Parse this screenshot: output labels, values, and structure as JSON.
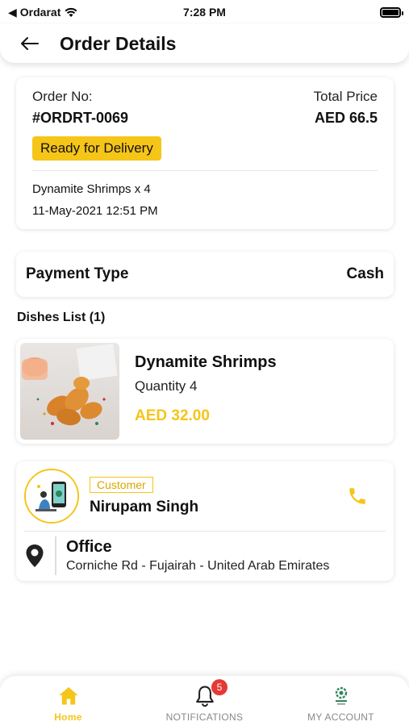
{
  "status_bar": {
    "carrier": "Ordarat",
    "time": "7:28 PM",
    "battery_level": 1.0
  },
  "header": {
    "title": "Order Details"
  },
  "order": {
    "number_label": "Order No:",
    "number": "#ORDRT-0069",
    "total_label": "Total Price",
    "total": "AED 66.5",
    "status": "Ready for Delivery",
    "item_summary": "Dynamite Shrimps x 4",
    "datetime": "11-May-2021 12:51 PM"
  },
  "payment": {
    "label": "Payment Type",
    "value": "Cash"
  },
  "dishes": {
    "title": "Dishes List (1)",
    "items": [
      {
        "name": "Dynamite Shrimps",
        "quantity": "Quantity 4",
        "price": "AED 32.00"
      }
    ]
  },
  "customer": {
    "badge": "Customer",
    "name": "Nirupam Singh",
    "address_title": "Office",
    "address": "Corniche Rd - Fujairah - United Arab Emirates"
  },
  "nav": {
    "items": [
      {
        "label": "Home",
        "icon": "home-icon",
        "active": true
      },
      {
        "label": "NOTIFICATIONS",
        "icon": "bell-icon",
        "badge": "5"
      },
      {
        "label": "MY ACCOUNT",
        "icon": "account-logo-icon"
      }
    ]
  },
  "colors": {
    "accent": "#f5c518",
    "badge_red": "#e53935"
  }
}
